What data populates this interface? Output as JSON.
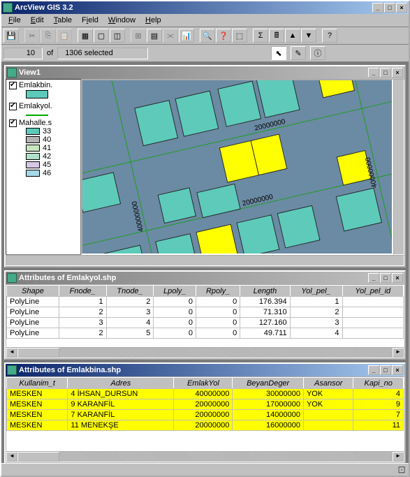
{
  "app": {
    "title": "ArcView GIS 3.2"
  },
  "menu": [
    "File",
    "Edit",
    "Table",
    "Field",
    "Window",
    "Help"
  ],
  "status": {
    "current": "10",
    "of": "of",
    "selected": "1306 selected"
  },
  "view": {
    "title": "View1",
    "layers": [
      {
        "name": "Emlakbin.",
        "checked": true,
        "swatch": "#5ecaba"
      },
      {
        "name": "Emlakyol.",
        "checked": true,
        "line": "#17a01a"
      },
      {
        "name": "Mahalle.s",
        "checked": true,
        "legend": [
          {
            "v": "33",
            "c": "#5ecaba"
          },
          {
            "v": "40",
            "c": "#b4b4b4"
          },
          {
            "v": "41",
            "c": "#c8e6c0"
          },
          {
            "v": "42",
            "c": "#b0e0ca"
          },
          {
            "v": "45",
            "c": "#d6c7e6"
          },
          {
            "v": "46",
            "c": "#a7d8e6"
          }
        ]
      }
    ],
    "road_labels": [
      "20000000",
      "20000000",
      "40000000",
      "40000000"
    ]
  },
  "table1": {
    "title": "Attributes of Emlakyol.shp",
    "cols": [
      "Shape",
      "Fnode_",
      "Tnode_",
      "Lpoly_",
      "Rpoly_",
      "Length",
      "Yol_pel_",
      "Yol_pel_id"
    ],
    "rows": [
      [
        "PolyLine",
        "1",
        "2",
        "0",
        "0",
        "176.394",
        "1",
        ""
      ],
      [
        "PolyLine",
        "2",
        "3",
        "0",
        "0",
        "71.310",
        "2",
        ""
      ],
      [
        "PolyLine",
        "3",
        "4",
        "0",
        "0",
        "127.160",
        "3",
        ""
      ],
      [
        "PolyLine",
        "2",
        "5",
        "0",
        "0",
        "49.711",
        "4",
        ""
      ]
    ]
  },
  "table2": {
    "title": "Attributes of Emlakbina.shp",
    "cols": [
      "Kullanim_t",
      "Adres",
      "EmlakYol",
      "BeyanDeger",
      "Asansor",
      "Kapi_no"
    ],
    "rows": [
      [
        "MESKEN",
        "4 İHSAN_DURSUN",
        "40000000",
        "30000000",
        "YOK",
        "4"
      ],
      [
        "MESKEN",
        "9 KARANFİL",
        "20000000",
        "17000000",
        "YOK",
        "9"
      ],
      [
        "MESKEN",
        "7 KARANFİL",
        "20000000",
        "14000000",
        "",
        "7"
      ],
      [
        "MESKEN",
        "11 MENEKŞE",
        "20000000",
        "16000000",
        "",
        "11"
      ]
    ]
  }
}
